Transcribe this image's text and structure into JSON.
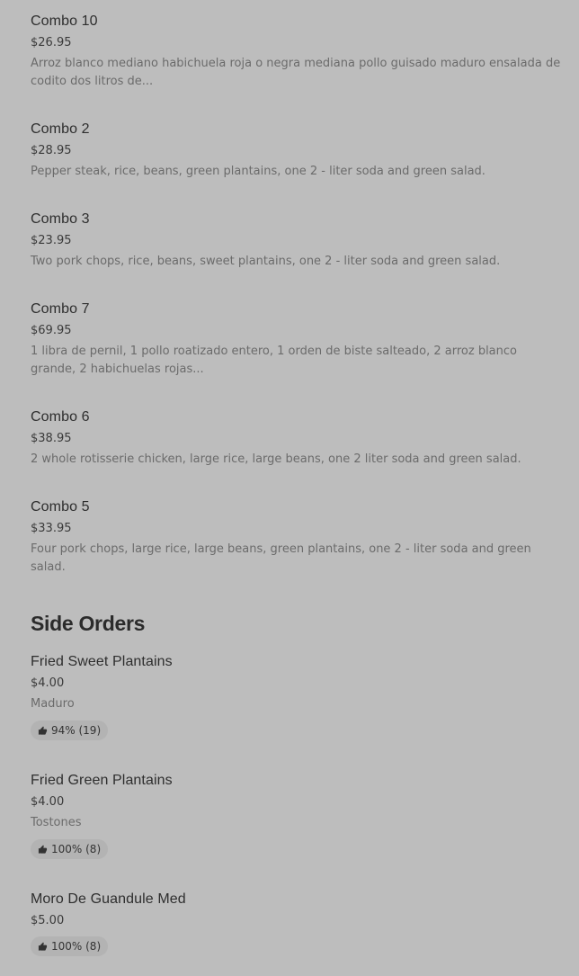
{
  "menu": {
    "combos": [
      {
        "title": "Combo 10",
        "price": "$26.95",
        "desc": "Arroz blanco mediano habichuela roja o negra mediana pollo guisado maduro ensalada de codito dos litros de..."
      },
      {
        "title": "Combo 2",
        "price": "$28.95",
        "desc": "Pepper steak, rice, beans, green plantains, one 2 - liter soda and green salad."
      },
      {
        "title": "Combo 3",
        "price": "$23.95",
        "desc": "Two pork chops, rice, beans, sweet plantains, one 2 - liter soda and green salad."
      },
      {
        "title": "Combo 7",
        "price": "$69.95",
        "desc": "1 libra de pernil, 1 pollo roatizado entero, 1 orden de biste salteado, 2 arroz blanco grande, 2 habichuelas rojas..."
      },
      {
        "title": "Combo 6",
        "price": "$38.95",
        "desc": "2 whole rotisserie chicken, large rice, large beans, one 2 liter soda and green salad."
      },
      {
        "title": "Combo 5",
        "price": "$33.95",
        "desc": "Four pork chops, large rice, large beans, green plantains, one 2 - liter soda and green salad."
      }
    ],
    "side_orders": {
      "heading": "Side Orders",
      "items": [
        {
          "title": "Fried Sweet Plantains",
          "price": "$4.00",
          "desc": "Maduro",
          "rating": "94% (19)"
        },
        {
          "title": "Fried Green Plantains",
          "price": "$4.00",
          "desc": "Tostones",
          "rating": "100% (8)"
        },
        {
          "title": "Moro De Guandule Med",
          "price": "$5.00",
          "rating": "100% (8)"
        }
      ]
    }
  },
  "icons": {
    "thumb": "thumbs-up-icon"
  },
  "colors": {
    "background": "#bdbdbd",
    "badge": "#b3b3b3"
  }
}
